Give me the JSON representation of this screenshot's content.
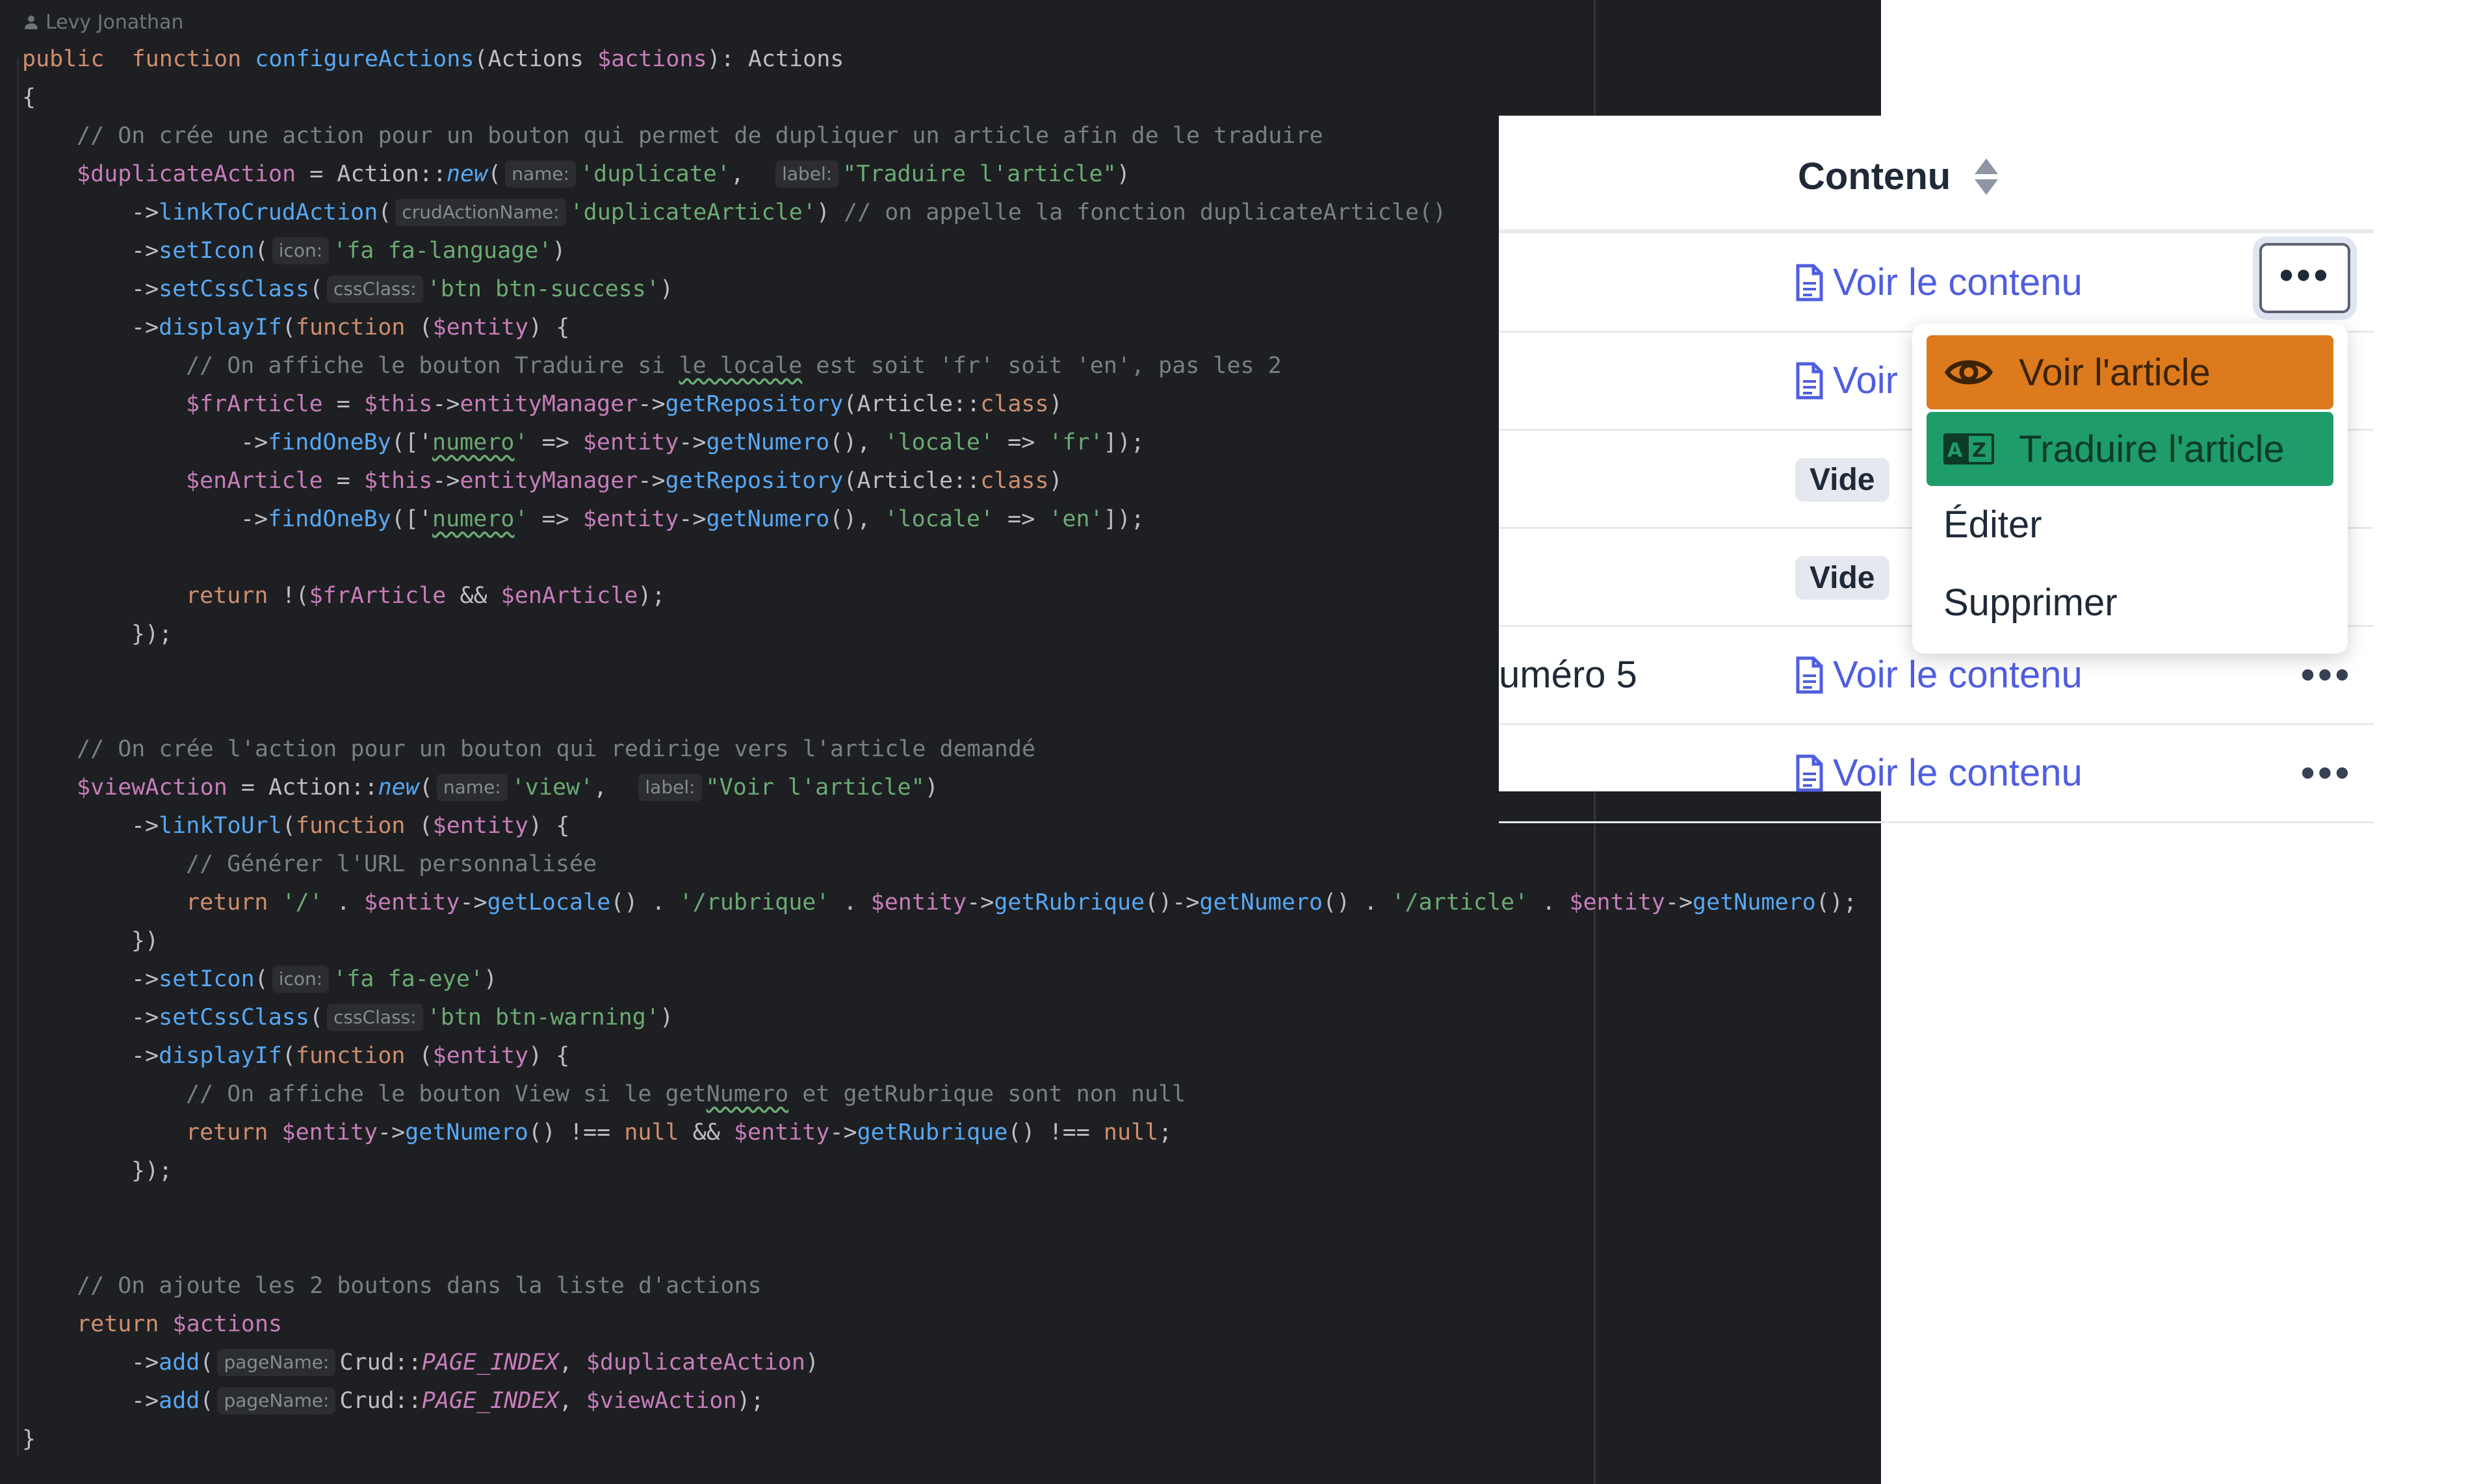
{
  "editor": {
    "author": "Levy Jonathan",
    "lines": [
      {
        "indent": 0,
        "tokens": [
          [
            "kw",
            "public"
          ],
          [
            "",
            "  "
          ],
          [
            "kw",
            "function"
          ],
          [
            "",
            ""
          ],
          [
            "fn",
            " configureActions"
          ],
          [
            "",
            "(Actions "
          ],
          [
            "var",
            "$actions"
          ],
          [
            "",
            "): Actions"
          ]
        ]
      },
      {
        "indent": 0,
        "tokens": [
          [
            "",
            "{"
          ]
        ]
      },
      {
        "indent": 1,
        "tokens": [
          [
            "com",
            "// On crée une action pour un bouton qui permet de dupliquer un article afin de le traduire"
          ]
        ]
      },
      {
        "indent": 1,
        "tokens": [
          [
            "var",
            "$duplicateAction"
          ],
          [
            "",
            " = Action::"
          ],
          [
            "fn it",
            "new"
          ],
          [
            "",
            "("
          ],
          [
            "hint",
            "name:"
          ],
          [
            "str",
            "'duplicate'"
          ],
          [
            "",
            ",  "
          ],
          [
            "hint",
            "label:"
          ],
          [
            "str",
            "\"Traduire l'article\""
          ],
          [
            "",
            ")"
          ]
        ]
      },
      {
        "indent": 2,
        "tokens": [
          [
            "",
            "->"
          ],
          [
            "fn",
            "linkToCrudAction"
          ],
          [
            "",
            "("
          ],
          [
            "hint",
            "crudActionName:"
          ],
          [
            "str",
            "'duplicateArticle'"
          ],
          [
            "",
            ") "
          ],
          [
            "com",
            "// on appelle la fonction duplicateArticle()"
          ]
        ]
      },
      {
        "indent": 2,
        "tokens": [
          [
            "",
            "->"
          ],
          [
            "fn",
            "setIcon"
          ],
          [
            "",
            "("
          ],
          [
            "hint",
            "icon:"
          ],
          [
            "str",
            "'fa fa-language'"
          ],
          [
            "",
            ")"
          ]
        ]
      },
      {
        "indent": 2,
        "tokens": [
          [
            "",
            "->"
          ],
          [
            "fn",
            "setCssClass"
          ],
          [
            "",
            "("
          ],
          [
            "hint",
            "cssClass:"
          ],
          [
            "str",
            "'btn btn-success'"
          ],
          [
            "",
            ")"
          ]
        ]
      },
      {
        "indent": 2,
        "tokens": [
          [
            "",
            "->"
          ],
          [
            "fn",
            "displayIf"
          ],
          [
            "",
            "("
          ],
          [
            "kw",
            "function"
          ],
          [
            "",
            " ("
          ],
          [
            "var",
            "$entity"
          ],
          [
            "",
            ") {"
          ]
        ]
      },
      {
        "indent": 3,
        "tokens": [
          [
            "com",
            "// On affiche le bouton Traduire si "
          ],
          [
            "com typo",
            "le locale"
          ],
          [
            "com",
            " est soit 'fr' soit 'en', pas les 2"
          ]
        ]
      },
      {
        "indent": 3,
        "tokens": [
          [
            "var",
            "$frArticle"
          ],
          [
            "",
            " = "
          ],
          [
            "var",
            "$this"
          ],
          [
            "",
            "->"
          ],
          [
            "prop",
            "entityManager"
          ],
          [
            "",
            "->"
          ],
          [
            "fn",
            "getRepository"
          ],
          [
            "",
            "(Article::"
          ],
          [
            "kw",
            "class"
          ],
          [
            "",
            ")"
          ]
        ]
      },
      {
        "indent": 4,
        "tokens": [
          [
            "",
            "->"
          ],
          [
            "fn",
            "findOneBy"
          ],
          [
            "",
            "(['"
          ],
          [
            "str typo",
            "numero"
          ],
          [
            "str",
            "'"
          ],
          [
            "",
            " => "
          ],
          [
            "var",
            "$entity"
          ],
          [
            "",
            "->"
          ],
          [
            "fn",
            "getNumero"
          ],
          [
            "",
            "(), "
          ],
          [
            "str",
            "'locale'"
          ],
          [
            "",
            " => "
          ],
          [
            "str",
            "'fr'"
          ],
          [
            "",
            "]);"
          ]
        ]
      },
      {
        "indent": 3,
        "tokens": [
          [
            "var",
            "$enArticle"
          ],
          [
            "",
            " = "
          ],
          [
            "var",
            "$this"
          ],
          [
            "",
            "->"
          ],
          [
            "prop",
            "entityManager"
          ],
          [
            "",
            "->"
          ],
          [
            "fn",
            "getRepository"
          ],
          [
            "",
            "(Article::"
          ],
          [
            "kw",
            "class"
          ],
          [
            "",
            ")"
          ]
        ]
      },
      {
        "indent": 4,
        "tokens": [
          [
            "",
            "->"
          ],
          [
            "fn",
            "findOneBy"
          ],
          [
            "",
            "(['"
          ],
          [
            "str typo",
            "numero"
          ],
          [
            "str",
            "'"
          ],
          [
            "",
            " => "
          ],
          [
            "var",
            "$entity"
          ],
          [
            "",
            "->"
          ],
          [
            "fn",
            "getNumero"
          ],
          [
            "",
            "(), "
          ],
          [
            "str",
            "'locale'"
          ],
          [
            "",
            " => "
          ],
          [
            "str",
            "'en'"
          ],
          [
            "",
            "]);"
          ]
        ]
      },
      {
        "indent": 3,
        "tokens": []
      },
      {
        "indent": 3,
        "tokens": [
          [
            "kw",
            "return"
          ],
          [
            "",
            " !("
          ],
          [
            "var",
            "$frArticle"
          ],
          [
            "",
            " && "
          ],
          [
            "var",
            "$enArticle"
          ],
          [
            "",
            ");"
          ]
        ]
      },
      {
        "indent": 2,
        "tokens": [
          [
            "",
            "});"
          ]
        ]
      },
      {
        "indent": 0,
        "tokens": []
      },
      {
        "indent": 0,
        "tokens": []
      },
      {
        "indent": 1,
        "tokens": [
          [
            "com",
            "// On crée l'action pour un bouton qui redirige vers l'article demandé"
          ]
        ]
      },
      {
        "indent": 1,
        "tokens": [
          [
            "var",
            "$viewAction"
          ],
          [
            "",
            " = Action::"
          ],
          [
            "fn it",
            "new"
          ],
          [
            "",
            "("
          ],
          [
            "hint",
            "name:"
          ],
          [
            "str",
            "'view'"
          ],
          [
            "",
            ",  "
          ],
          [
            "hint",
            "label:"
          ],
          [
            "str",
            "\"Voir l'article\""
          ],
          [
            "",
            ")"
          ]
        ]
      },
      {
        "indent": 2,
        "tokens": [
          [
            "",
            "->"
          ],
          [
            "fn",
            "linkToUrl"
          ],
          [
            "",
            "("
          ],
          [
            "kw",
            "function"
          ],
          [
            "",
            " ("
          ],
          [
            "var",
            "$entity"
          ],
          [
            "",
            ") {"
          ]
        ]
      },
      {
        "indent": 3,
        "tokens": [
          [
            "com",
            "// Générer l'URL personnalisée"
          ]
        ]
      },
      {
        "indent": 3,
        "tokens": [
          [
            "kw",
            "return"
          ],
          [
            "str",
            " '/'"
          ],
          [
            "",
            " . "
          ],
          [
            "var",
            "$entity"
          ],
          [
            "",
            "->"
          ],
          [
            "fn",
            "getLocale"
          ],
          [
            "",
            "() . "
          ],
          [
            "str",
            "'/rubrique'"
          ],
          [
            "",
            " . "
          ],
          [
            "var",
            "$entity"
          ],
          [
            "",
            "->"
          ],
          [
            "fn",
            "getRubrique"
          ],
          [
            "",
            "()->"
          ],
          [
            "fn",
            "getNumero"
          ],
          [
            "",
            "() . "
          ],
          [
            "str",
            "'/article'"
          ],
          [
            "",
            " . "
          ],
          [
            "var",
            "$entity"
          ],
          [
            "",
            "->"
          ],
          [
            "fn",
            "getNumero"
          ],
          [
            "",
            "();"
          ]
        ]
      },
      {
        "indent": 2,
        "tokens": [
          [
            "",
            "})"
          ]
        ]
      },
      {
        "indent": 2,
        "tokens": [
          [
            "",
            "->"
          ],
          [
            "fn",
            "setIcon"
          ],
          [
            "",
            "("
          ],
          [
            "hint",
            "icon:"
          ],
          [
            "str",
            "'fa fa-eye'"
          ],
          [
            "",
            ")"
          ]
        ]
      },
      {
        "indent": 2,
        "tokens": [
          [
            "",
            "->"
          ],
          [
            "fn",
            "setCssClass"
          ],
          [
            "",
            "("
          ],
          [
            "hint",
            "cssClass:"
          ],
          [
            "str",
            "'btn btn-warning'"
          ],
          [
            "",
            ")"
          ]
        ]
      },
      {
        "indent": 2,
        "tokens": [
          [
            "",
            "->"
          ],
          [
            "fn",
            "displayIf"
          ],
          [
            "",
            "("
          ],
          [
            "kw",
            "function"
          ],
          [
            "",
            " ("
          ],
          [
            "var",
            "$entity"
          ],
          [
            "",
            ") {"
          ]
        ]
      },
      {
        "indent": 3,
        "tokens": [
          [
            "com",
            "// On affiche le bouton View si le get"
          ],
          [
            "com typo",
            "Numero"
          ],
          [
            "com",
            " et getRubrique sont non null"
          ]
        ]
      },
      {
        "indent": 3,
        "tokens": [
          [
            "kw",
            "return"
          ],
          [
            "var",
            " $entity"
          ],
          [
            "",
            "->"
          ],
          [
            "fn",
            "getNumero"
          ],
          [
            "",
            "() !== "
          ],
          [
            "kw",
            "null"
          ],
          [
            "",
            " && "
          ],
          [
            "var",
            "$entity"
          ],
          [
            "",
            "->"
          ],
          [
            "fn",
            "getRubrique"
          ],
          [
            "",
            "() !== "
          ],
          [
            "kw",
            "null"
          ],
          [
            "",
            ";"
          ]
        ]
      },
      {
        "indent": 2,
        "tokens": [
          [
            "",
            "});"
          ]
        ]
      },
      {
        "indent": 0,
        "tokens": []
      },
      {
        "indent": 0,
        "tokens": []
      },
      {
        "indent": 1,
        "tokens": [
          [
            "com",
            "// On ajoute les 2 boutons dans la liste d'actions"
          ]
        ]
      },
      {
        "indent": 1,
        "tokens": [
          [
            "kw",
            "return"
          ],
          [
            "var",
            " $actions"
          ]
        ]
      },
      {
        "indent": 2,
        "tokens": [
          [
            "",
            "->"
          ],
          [
            "fn",
            "add"
          ],
          [
            "",
            "("
          ],
          [
            "hint",
            "pageName:"
          ],
          [
            "",
            "Crud::"
          ],
          [
            "var it",
            "PAGE_INDEX"
          ],
          [
            "",
            ", "
          ],
          [
            "var",
            "$duplicateAction"
          ],
          [
            "",
            ")"
          ]
        ]
      },
      {
        "indent": 2,
        "tokens": [
          [
            "",
            "->"
          ],
          [
            "fn",
            "add"
          ],
          [
            "",
            "("
          ],
          [
            "hint",
            "pageName:"
          ],
          [
            "",
            "Crud::"
          ],
          [
            "var it",
            "PAGE_INDEX"
          ],
          [
            "",
            ", "
          ],
          [
            "var",
            "$viewAction"
          ],
          [
            "",
            ");"
          ]
        ]
      },
      {
        "indent": 0,
        "tokens": [
          [
            "",
            "}"
          ]
        ]
      }
    ]
  },
  "table": {
    "header": "Contenu",
    "rows": [
      {
        "left": "",
        "content": "Voir le contenu",
        "type": "link"
      },
      {
        "left": "",
        "content": "Voir",
        "type": "link"
      },
      {
        "left": "",
        "content": "Vide",
        "type": "badge"
      },
      {
        "left": "",
        "content": "Vide",
        "type": "badge"
      },
      {
        "left": "uméro 5",
        "content": "Voir le contenu",
        "type": "link"
      },
      {
        "left": "",
        "content": "Voir le contenu",
        "type": "link"
      }
    ],
    "dots": "•••"
  },
  "dropdown": {
    "view": "Voir l'article",
    "translate": "Traduire l'article",
    "edit": "Éditer",
    "delete": "Supprimer"
  },
  "colors": {
    "warning": "#dd7a1d",
    "success": "#1e9c6a",
    "link": "#4f5ee0"
  },
  "icons": {
    "author": "user-icon",
    "sort": "sort-icon",
    "file": "file-icon",
    "eye": "eye-icon",
    "language": "language-icon"
  }
}
